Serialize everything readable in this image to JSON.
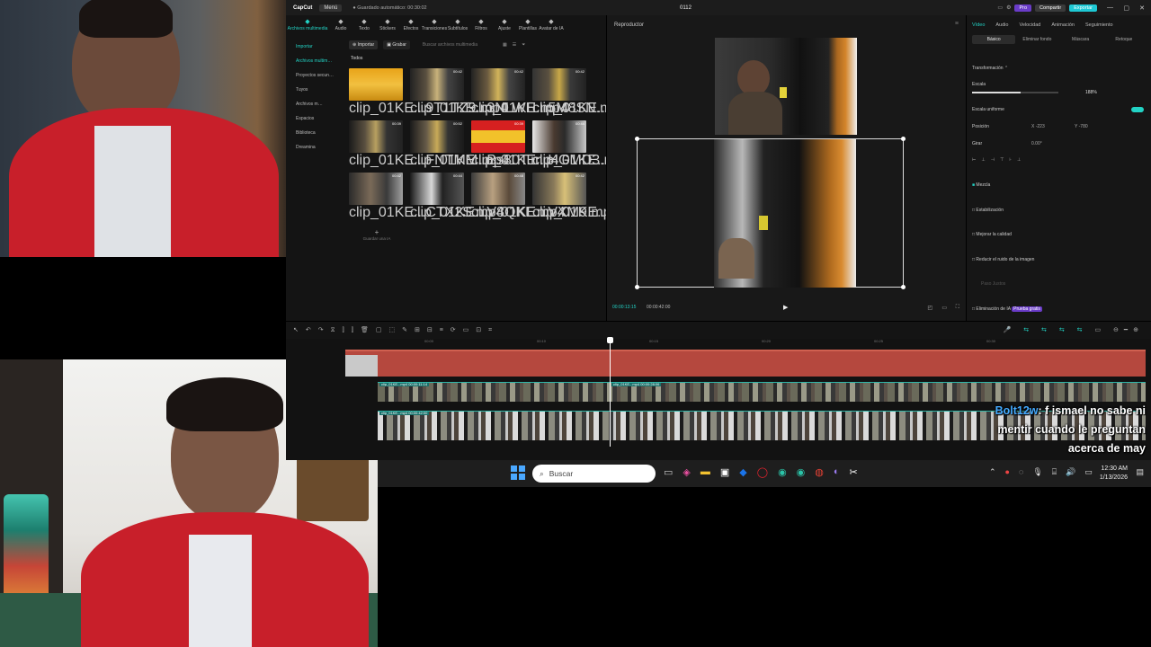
{
  "window": {
    "app_name": "CapCut",
    "menu_label": "Menú",
    "autosave_text": "Guardado automático: 00:30:02",
    "doc_title": "0112",
    "pro_label": "Pro",
    "share_label": "Compartir",
    "export_label": "Exportar"
  },
  "toolbar": {
    "tools": [
      {
        "icon": "media-icon",
        "label": "Archivos multimedia",
        "active": true
      },
      {
        "icon": "audio-icon",
        "label": "Audio"
      },
      {
        "icon": "text-icon",
        "label": "Texto"
      },
      {
        "icon": "sticker-icon",
        "label": "Stickers"
      },
      {
        "icon": "effects-icon",
        "label": "Efectos"
      },
      {
        "icon": "transitions-icon",
        "label": "Transiciones"
      },
      {
        "icon": "subtitles-icon",
        "label": "Subtítulos"
      },
      {
        "icon": "filters-icon",
        "label": "Filtros"
      },
      {
        "icon": "adjust-icon",
        "label": "Ajuste"
      },
      {
        "icon": "templates-icon",
        "label": "Plantillas"
      },
      {
        "icon": "ai-avatar-icon",
        "label": "Avatar de IA"
      }
    ]
  },
  "leftnav": {
    "items": [
      "Importar",
      "Archivos multim…",
      "Proyectos secun…",
      "Tuyos",
      "Archivos m…",
      "Espacios",
      "Biblioteca",
      "Dreamina"
    ]
  },
  "media": {
    "import_label": "Importar",
    "record_label": "Grabar",
    "search_placeholder": "Buscar archivos multimedia",
    "all_label": "Todos",
    "add_label": "Guardar una IA",
    "items": [
      {
        "name": "clip_01KE...9T1TZ9.mp4",
        "duration": ""
      },
      {
        "name": "clip_01KE...3NLWH.mp4",
        "duration": "00:42"
      },
      {
        "name": "clip_01KE...5M8SN.mp4",
        "duration": "00:42"
      },
      {
        "name": "clip_01KE...QR9FD.mp4",
        "duration": "00:42"
      },
      {
        "name": "clip_01KE...FNTMM.mp4",
        "duration": "00:39"
      },
      {
        "name": "clip_01KE...Bs80T.mp4",
        "duration": "00:52"
      },
      {
        "name": "clip_01KE...HGMD3.mp4",
        "duration": "00:39"
      },
      {
        "name": "clip_01KE...QCEAP.mp4",
        "duration": "00:44"
      },
      {
        "name": "clip_01KE...CTX2S.mp4",
        "duration": "00:42"
      },
      {
        "name": "clip_01KE...V8QKL.mp4",
        "duration": "00:44"
      },
      {
        "name": "clip_01KE...VXM9.mp4",
        "duration": "00:48"
      },
      {
        "name": "clip_01KE...6T730.mp4",
        "duration": "00:42"
      }
    ]
  },
  "player": {
    "header": "Reproductor",
    "current_time": "00:00:13:15",
    "total_time": "00:00:42:00"
  },
  "props": {
    "tabs": [
      "Vídeo",
      "Audio",
      "Velocidad",
      "Animación",
      "Seguimiento"
    ],
    "subtabs": [
      "Básico",
      "Eliminar fondo",
      "Máscara",
      "Retoque"
    ],
    "transform_label": "Transformación",
    "scale_label": "Escala",
    "scale_value": "188%",
    "scale_fraction": 0.56,
    "uniform_label": "Escala uniforme",
    "position_label": "Posición",
    "pos_x": "-223",
    "pos_y": "-780",
    "rotate_label": "Girar",
    "rotate_value": "0.00°",
    "blend_label": "Mezcla",
    "stabilize_label": "Estabilización",
    "enhance_label": "Mejorar la calidad",
    "denoise_label": "Reducir el ruido de la imagen",
    "frame_label": "Paso Justos",
    "ai_remove_label": "Eliminación de IA",
    "ai_badge": "Prueba gratis"
  },
  "timeline": {
    "ticks": [
      "00:00",
      "00:10",
      "00:15",
      "00:20",
      "00:25",
      "00:30"
    ],
    "track1_label": "clip_01KE...mp4  00:00:11:14",
    "track1_label2": "clip_01KE...mp4  00:00:28:06",
    "track2_label": "clip_01KE...mp4  00:00:42:00"
  },
  "taskbar": {
    "search_placeholder": "Buscar",
    "time": "12:30 AM",
    "date": "1/13/2026"
  },
  "chat": {
    "username": "Bolt12w",
    "message": ": f ismael no sabe ni mentir cuando le preguntan acerca de may"
  },
  "colors": {
    "accent": "#22d3c5",
    "export": "#1ec8d4",
    "audio_track": "#b5483e",
    "jacket": "#c81f2a"
  }
}
